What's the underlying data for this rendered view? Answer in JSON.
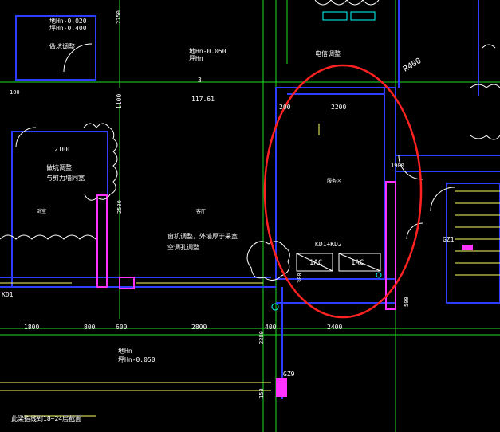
{
  "colors": {
    "background": "#000000",
    "wall_blue": "#2d3cff",
    "axis_green": "#22dd22",
    "magenta": "#ff33ff",
    "yellow": "#ffff66",
    "cyan": "#00ffff",
    "white": "#ffffff",
    "markup_red": "#ff2222"
  },
  "labels": {
    "level_top1": "地Hn-0.020",
    "level_top2": "坪Hn-0.400",
    "adjust1": "做坑调整",
    "level_mid1": "地Hn-0.050",
    "level_mid2": "坪Hn",
    "num3": "3",
    "num117": "117.61",
    "ann_elec": "电信调整",
    "ann_wall1": "做坑调整",
    "ann_wall2": "与剪力墙同宽",
    "ann_window1": "窗机调整，外墙厚于采宽",
    "ann_window2": "空调孔调整",
    "kd_label": "KD1+KD2",
    "ac1": "1AC",
    "ac2": "1AC",
    "kd1": "KD1",
    "gz1": "GZ1",
    "gz9": "GZ9",
    "r400": "R400",
    "level_bot1": "地Hn",
    "level_bot2": "坪Hn-0.050",
    "bottom_note": "此梁指线到18~24层截面",
    "room_mid": "客厅",
    "room_left": "卧室",
    "room_right": "服务区",
    "dim_2200": "2200",
    "dim_2100": "2100",
    "dim_2800": "2800",
    "dim_2400": "2400",
    "dim_1800": "1800",
    "dim_800": "800",
    "dim_600": "600",
    "dim_200": "200",
    "dim_400": "400",
    "dim_1100": "1100",
    "dim_100": "100",
    "dim_500": "500",
    "dim_1900": "1900",
    "dim_2750": "2750",
    "dim_2200v": "2200",
    "dim_300": "300",
    "dim_150": "150",
    "dim_2500": "2500"
  }
}
